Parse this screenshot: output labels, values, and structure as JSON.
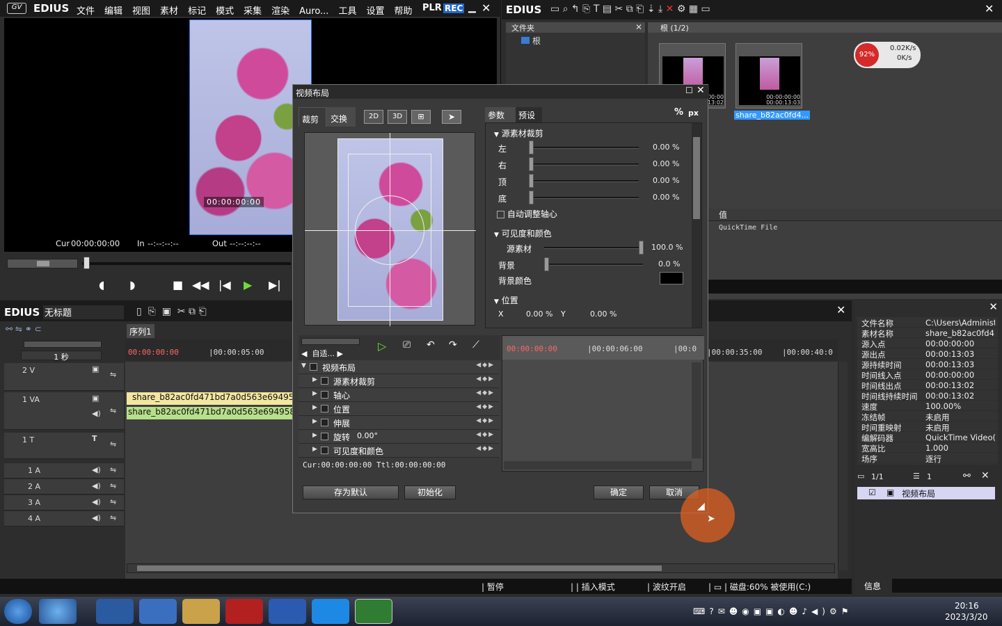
{
  "app": {
    "logo": "EDIUS",
    "plr_label": "PLR",
    "rec_label": "REC"
  },
  "menu": [
    "文件",
    "编辑",
    "视图",
    "素材",
    "标记",
    "模式",
    "采集",
    "渲染",
    "Auro...",
    "工具",
    "设置",
    "帮助"
  ],
  "player": {
    "cur_label": "Cur",
    "cur_value": "00:00:00:00",
    "in_label": "In",
    "in_value": "--:--:--:--",
    "out_label": "Out",
    "out_value": "--:--:--:--",
    "overlay_timecode": "00:00:00:00"
  },
  "bin": {
    "title": "EDIUS",
    "folder_panel_title": "文件夹",
    "root_label": "根",
    "bin_header": "根 (1/2)",
    "clips": [
      {
        "tc1": "00:00:00:00",
        "tc2": "13:02"
      },
      {
        "tc1": "00:00:00:00",
        "tc2": "00:00:13:03",
        "name": "share_b82ac0fd4..."
      }
    ],
    "net_widget": {
      "percent": "92%",
      "up": "0.02K/s",
      "down": "0K/s"
    },
    "value_header": "值",
    "value_cell": "QuickTime File"
  },
  "timeline": {
    "logo": "EDIUS",
    "project_name": "无标题",
    "sequence_tab": "序列1",
    "scale_label": "1 秒",
    "ruler": [
      "00:00:00:00",
      "|00:00:05:00",
      "|00:00:35:00",
      "|00:00:40:0"
    ],
    "tracks": [
      {
        "name": "2 V"
      },
      {
        "name": "1 VA"
      },
      {
        "name": "1 T"
      },
      {
        "name": "1 A"
      },
      {
        "name": "2 A"
      },
      {
        "name": "3 A"
      },
      {
        "name": "4 A"
      }
    ],
    "clip_video": "share_b82ac0fd471bd7a0d563e694958f2",
    "clip_audio": "share_b82ac0fd471bd7a0d563e694958f2b",
    "status": {
      "pause": "暂停",
      "insert": "插入模式",
      "ripple": "波纹开启",
      "disk": "磁盘:60% 被使用(C:)"
    }
  },
  "dialog": {
    "title": "视频布局",
    "tab_crop": "裁剪",
    "tab_transform": "交换",
    "mode_2d": "2D",
    "mode_3d": "3D",
    "param_tab": "参数",
    "preset_tab": "预设",
    "unit_pct": "%",
    "unit_px": "px",
    "section_crop": "源素材裁剪",
    "crop_rows": [
      {
        "label": "左",
        "value": "0.00 %"
      },
      {
        "label": "右",
        "value": "0.00 %"
      },
      {
        "label": "顶",
        "value": "0.00 %"
      },
      {
        "label": "底",
        "value": "0.00 %"
      }
    ],
    "auto_center": "自动调整轴心",
    "section_visibility": "可见度和颜色",
    "source_label": "源素材",
    "source_value": "100.0 %",
    "source_level": 1.0,
    "bg_label": "背景",
    "bg_value": "0.0 %",
    "bg_color_label": "背景颜色",
    "section_position": "位置",
    "pos_x_label": "X",
    "pos_x_value": "0.00 %",
    "pos_y_label": "Y",
    "pos_y_value": "0.00 %",
    "kf_fit": "自适...",
    "kf_rows": [
      {
        "label": "视频布局",
        "value": ""
      },
      {
        "label": "源素材裁剪",
        "value": ""
      },
      {
        "label": "轴心",
        "value": ""
      },
      {
        "label": "位置",
        "value": ""
      },
      {
        "label": "伸展",
        "value": ""
      },
      {
        "label": "旋转",
        "value": "0.00°"
      },
      {
        "label": "可见度和颜色",
        "value": ""
      }
    ],
    "kf_time": "00:00:00:00",
    "kf_cur": "Cur:00:00:00:00",
    "kf_total": "Ttl:00:00:00:00",
    "kf_ruler_2": "|00:00:06:00",
    "kf_ruler_3": "|00:0",
    "save_default": "存为默认",
    "init": "初始化",
    "ok": "确定",
    "cancel": "取消"
  },
  "info": {
    "rows": [
      {
        "k": "文件名称",
        "v": "C:\\Users\\Administ..."
      },
      {
        "k": "素材名称",
        "v": "share_b82ac0fd4..."
      },
      {
        "k": "源入点",
        "v": "00:00:00:00"
      },
      {
        "k": "源出点",
        "v": "00:00:13:03"
      },
      {
        "k": "源持续时间",
        "v": "00:00:13:03"
      },
      {
        "k": "时间线入点",
        "v": "00:00:00:00"
      },
      {
        "k": "时间线出点",
        "v": "00:00:13:02"
      },
      {
        "k": "时间线持续时间",
        "v": "00:00:13:02"
      },
      {
        "k": "速度",
        "v": "100.00%"
      },
      {
        "k": "冻结帧",
        "v": "未启用"
      },
      {
        "k": "时间重映射",
        "v": "未启用"
      },
      {
        "k": "编解码器",
        "v": "QuickTime Video(a..."
      },
      {
        "k": "宽高比",
        "v": "1.000"
      },
      {
        "k": "场序",
        "v": "逐行"
      }
    ],
    "page_a": "1/1",
    "page_b": "1",
    "effect_item": "视频布局",
    "tab_info": "信息"
  },
  "taskbar": {
    "time": "20:16",
    "date": "2023/3/20"
  },
  "colors": {
    "accent": "#3399ff",
    "clip_video": "#f3e7a0",
    "clip_audio": "#b8e08a",
    "cursor_ring": "#e06020"
  }
}
